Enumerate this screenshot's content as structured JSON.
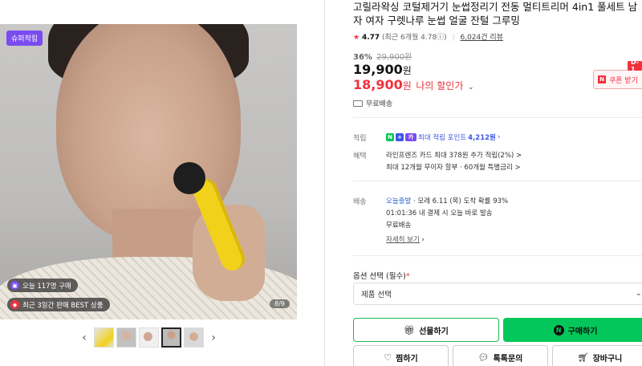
{
  "image": {
    "badge": "슈퍼적립",
    "pill1": "오늘 117명 구매",
    "pill2": "최근 3일간 판매 BEST 상품",
    "page_count": "8/9"
  },
  "product": {
    "title": "고릴라왁싱 코털제거기 눈썹정리기 전동 멀티트리머 4in1 풀세트 남자 여자 구렛나루 눈썹 얼굴 잔털 그루밍",
    "rating": "4.77",
    "rating_detail": "(최근 6개월 4.78",
    "review_count": "6,024건 리뷰",
    "discount_pct": "36%",
    "original_price": "29,900원",
    "price": "19,900",
    "my_price": "18,900",
    "won": "원",
    "my_price_label": "나의 할인가",
    "coupon_label": "쿠폰 받기",
    "dday": "D-1",
    "shipping": "무료배송"
  },
  "benefits": {
    "points_label": "적립",
    "points_text_prefix": "최대 적립 포인트",
    "points_value": "4,212원",
    "benefit_label": "혜택",
    "benefit_line1": "라인프렌즈 카드 최대 378원 추가 적립(2%) >",
    "benefit_line2": "최대 12개월 무이자 할부 · 60개월 특별금리 >"
  },
  "delivery": {
    "label": "배송",
    "today": "오늘출발",
    "arrival": " · 모레 6.11 (목) 도착 확률 93%",
    "cutoff": "01:01:36  내 결제 시 오늘 바로 발송",
    "fee": "무료배송",
    "detail_link": "자세히 보기"
  },
  "options": {
    "title": "옵션 선택 (필수)",
    "required_mark": "*",
    "select_placeholder": "제품 선택"
  },
  "buttons": {
    "gift": "선물하기",
    "buy": "구매하기",
    "wish": "찜하기",
    "talk": "톡톡문의",
    "cart": "장바구니"
  },
  "colors": {
    "accent_red": "#f2303d",
    "naver_green": "#03c75a",
    "points_blue": "#3b57e8"
  }
}
